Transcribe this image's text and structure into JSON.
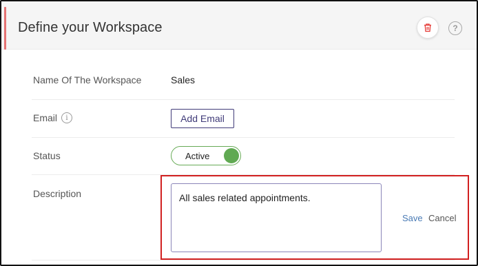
{
  "header": {
    "title": "Define your Workspace",
    "delete_icon": "trash-icon",
    "help_icon": "question-circle-icon",
    "help_glyph": "?"
  },
  "fields": {
    "name": {
      "label": "Name Of The Workspace",
      "value": "Sales"
    },
    "email": {
      "label": "Email",
      "info_glyph": "i",
      "button_label": "Add Email"
    },
    "status": {
      "label": "Status",
      "toggle_label": "Active",
      "enabled": true
    },
    "description": {
      "label": "Description",
      "value": "All sales related appointments.",
      "save_label": "Save",
      "cancel_label": "Cancel"
    }
  },
  "colors": {
    "accent_bar": "#e57373",
    "toggle_on": "#60a952",
    "button_border": "#3f3a78",
    "highlight_border": "#d11f1f",
    "save_link": "#4a7bb5"
  }
}
